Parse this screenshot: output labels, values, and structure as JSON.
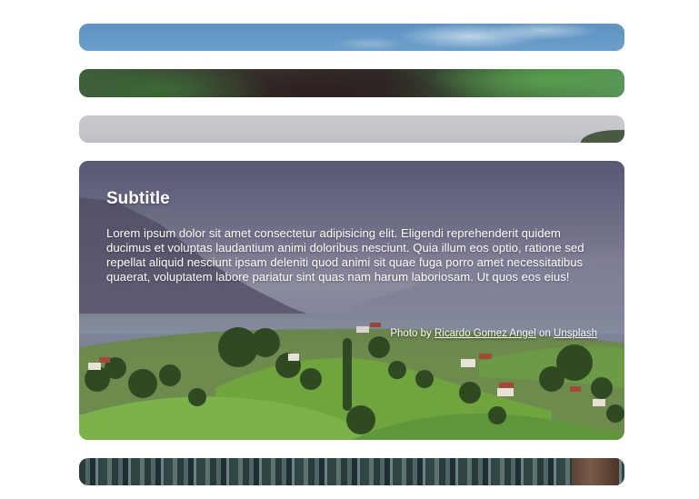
{
  "panels": [
    {
      "id": "panel-1",
      "state": "collapsed"
    },
    {
      "id": "panel-2",
      "state": "collapsed"
    },
    {
      "id": "panel-3",
      "state": "collapsed"
    },
    {
      "id": "panel-4",
      "state": "expanded",
      "title": "Subtitle",
      "body": "Lorem ipsum dolor sit amet consectetur adipisicing elit. Eligendi reprehenderit quidem ducimus et voluptas laudantium animi doloribus nesciunt. Quia illum eos optio, ratione sed repellat aliquid nesciunt ipsam deleniti quod animi sit quae fuga porro amet necessitatibus quaerat, voluptatem labore pariatur sint quas nam harum laboriosam. Ut quos eos eius!",
      "credit": {
        "prefix": "Photo by",
        "author": "Ricardo Gomez Angel",
        "middle": "on",
        "source": "Unsplash"
      }
    },
    {
      "id": "panel-5",
      "state": "collapsed"
    }
  ],
  "colors": {
    "page_background": "#ffffff",
    "text": "#ffffff"
  }
}
